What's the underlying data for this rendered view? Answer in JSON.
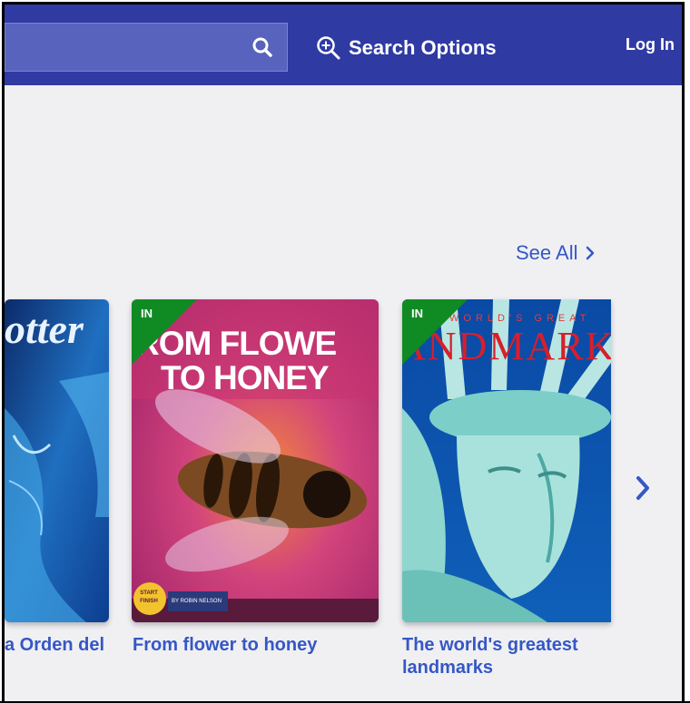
{
  "header": {
    "search_options_label": "Search Options",
    "login_label": "Log In"
  },
  "section": {
    "see_all_label": "See All"
  },
  "books": [
    {
      "title": "a Orden del",
      "cover_text": "otter"
    },
    {
      "title": "From flower to honey",
      "badge": "IN",
      "cover_line1": "ROM FLOWE",
      "cover_line2": "TO HONEY",
      "author": "BY ROBIN NELSON",
      "logo_text": "START FINISH"
    },
    {
      "title_line1": "The world's greatest",
      "title_line2": "landmarks",
      "badge": "IN",
      "cover_line1": "WORLD'S GREAT",
      "cover_line2": "ANDMARK"
    }
  ],
  "colors": {
    "header_bg": "#2f3aa3",
    "link": "#3557c6",
    "badge": "#108a22",
    "page_bg": "#f0f0f3"
  }
}
